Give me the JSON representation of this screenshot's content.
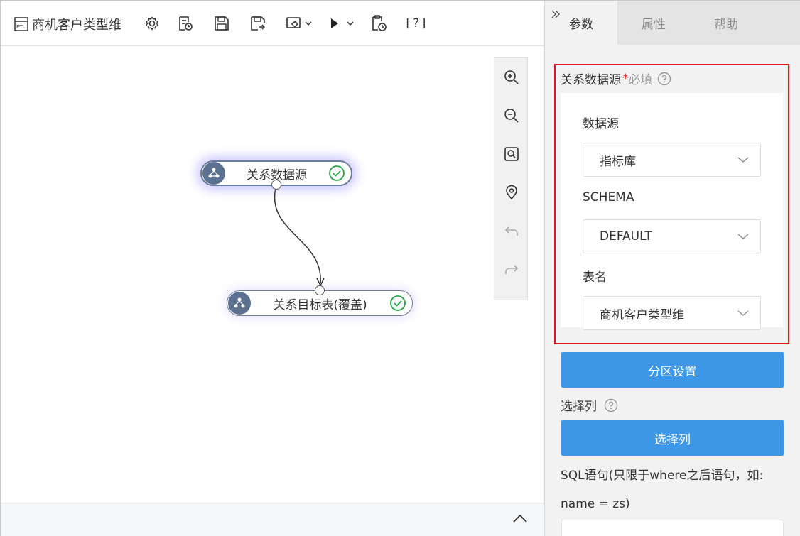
{
  "toolbar": {
    "title": "商机客户类型维",
    "help_label": "[?]",
    "icons": [
      "etl-icon",
      "settings-icon",
      "log-icon",
      "save-icon",
      "save-as-icon",
      "config-dropdown-icon",
      "run-dropdown-icon",
      "schedule-icon",
      "help-icon"
    ]
  },
  "canvas": {
    "source_node": {
      "label": "关系数据源",
      "status": "success"
    },
    "target_node": {
      "label": "关系目标表(覆盖)",
      "status": "success"
    },
    "zoom_tools": [
      "zoom-in-icon",
      "zoom-out-icon",
      "fit-view-icon",
      "locate-icon",
      "undo-icon",
      "redo-icon"
    ]
  },
  "panel": {
    "tabs": [
      {
        "label": "参数",
        "active": true
      },
      {
        "label": "属性",
        "active": false
      },
      {
        "label": "帮助",
        "active": false
      }
    ],
    "section_title": "关系数据源",
    "required_mark": "*",
    "required_text": "必填",
    "datasource_label": "数据源",
    "datasource_value": "指标库",
    "schema_label": "SCHEMA",
    "schema_value": "DEFAULT",
    "table_label": "表名",
    "table_value": "商机客户类型维",
    "partition_button": "分区设置",
    "select_cols_label": "选择列",
    "select_cols_button": "选择列",
    "sql_hint_line1": "SQL语句(只限于where之后语句，如:",
    "sql_hint_line2": "name = zs)"
  },
  "colors": {
    "accent_blue": "#3d97e6",
    "highlight_red": "#e0151d",
    "success_green": "#25a844",
    "node_icon": "#5c7090"
  }
}
